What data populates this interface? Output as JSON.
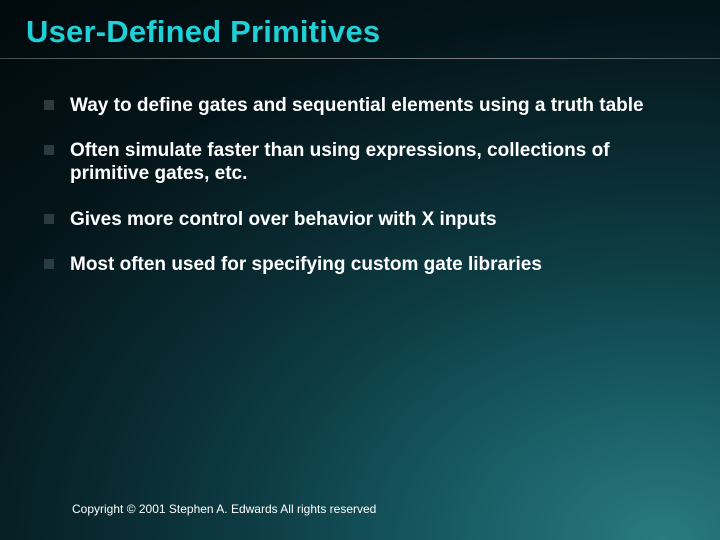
{
  "title": "User-Defined Primitives",
  "bullets": [
    "Way to define gates and sequential elements using a truth table",
    "Often simulate faster than using expressions, collections of primitive gates, etc.",
    "Gives more control over behavior with X inputs",
    "Most often used for specifying custom gate libraries"
  ],
  "footer": "Copyright © 2001 Stephen A. Edwards  All rights reserved"
}
